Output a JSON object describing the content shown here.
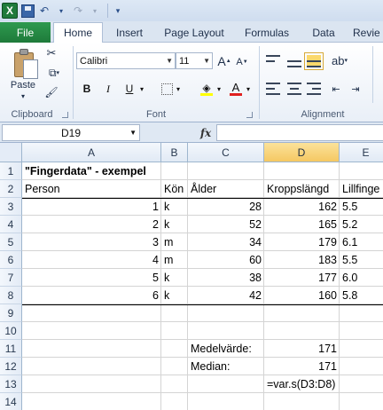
{
  "qat": {
    "app_icon": "X"
  },
  "tabs": [
    "File",
    "Home",
    "Insert",
    "Page Layout",
    "Formulas",
    "Data",
    "Revie"
  ],
  "ribbon": {
    "paste_label": "Paste",
    "font_name": "Calibri",
    "font_size": "11",
    "grow_font": "A",
    "shrink_font": "A",
    "bold": "B",
    "italic": "I",
    "underline": "U",
    "font_color": "A",
    "groups": {
      "clipboard": "Clipboard",
      "font": "Font",
      "alignment": "Alignment"
    }
  },
  "formula_bar": {
    "name_box": "D19",
    "fx": "fx",
    "content": ""
  },
  "grid": {
    "columns": [
      "A",
      "B",
      "C",
      "D",
      "E"
    ],
    "selected_column": "D",
    "rows": [
      "1",
      "2",
      "3",
      "4",
      "5",
      "6",
      "7",
      "8",
      "9",
      "10",
      "11",
      "12",
      "13",
      "14"
    ],
    "title": "\"Fingerdata\" - exempel",
    "headers": [
      "Person",
      "Kön",
      "Ålder",
      "Kroppslängd",
      "Lillfinge"
    ],
    "data": [
      {
        "person": "1",
        "kon": "k",
        "alder": "28",
        "langd": "162",
        "lill": "5.5"
      },
      {
        "person": "2",
        "kon": "k",
        "alder": "52",
        "langd": "165",
        "lill": "5.2"
      },
      {
        "person": "3",
        "kon": "m",
        "alder": "34",
        "langd": "179",
        "lill": "6.1"
      },
      {
        "person": "4",
        "kon": "m",
        "alder": "60",
        "langd": "183",
        "lill": "5.5"
      },
      {
        "person": "5",
        "kon": "k",
        "alder": "38",
        "langd": "177",
        "lill": "6.0"
      },
      {
        "person": "6",
        "kon": "k",
        "alder": "42",
        "langd": "160",
        "lill": "5.8"
      }
    ],
    "stats": {
      "mean_label": "Medelvärde:",
      "mean_value": "171",
      "median_label": "Median:",
      "median_value": "171",
      "formula": "=var.s(D3:D8)"
    }
  },
  "colors": {
    "file_tab": "#1e7a3a",
    "selected_header": "#f5c862"
  }
}
